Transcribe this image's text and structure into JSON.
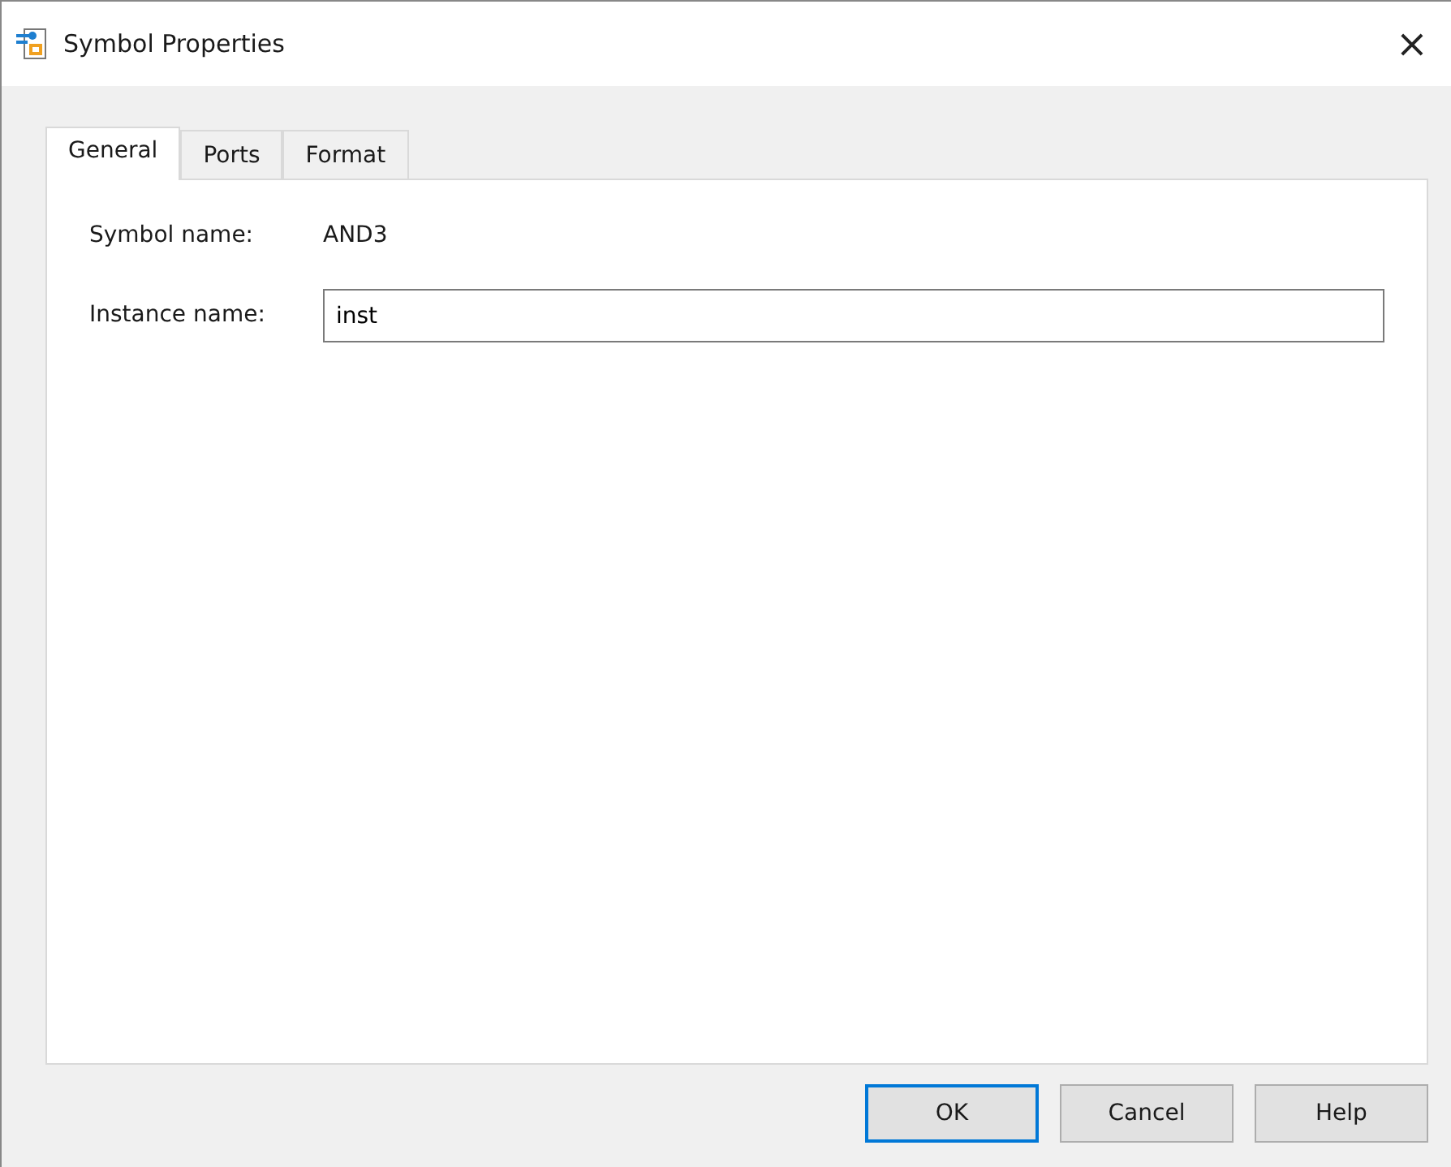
{
  "window": {
    "title": "Symbol Properties",
    "close": "×"
  },
  "tabs": [
    {
      "label": "General",
      "selected": true
    },
    {
      "label": "Ports",
      "selected": false
    },
    {
      "label": "Format",
      "selected": false
    }
  ],
  "fields": [
    {
      "kind": "static",
      "label": "Symbol name:",
      "value": "AND3"
    },
    {
      "kind": "input",
      "label": "Instance name:",
      "value": "inst"
    }
  ],
  "buttons": [
    {
      "label": "OK",
      "default": true
    },
    {
      "label": "Cancel",
      "default": false
    },
    {
      "label": "Help",
      "default": false
    }
  ]
}
